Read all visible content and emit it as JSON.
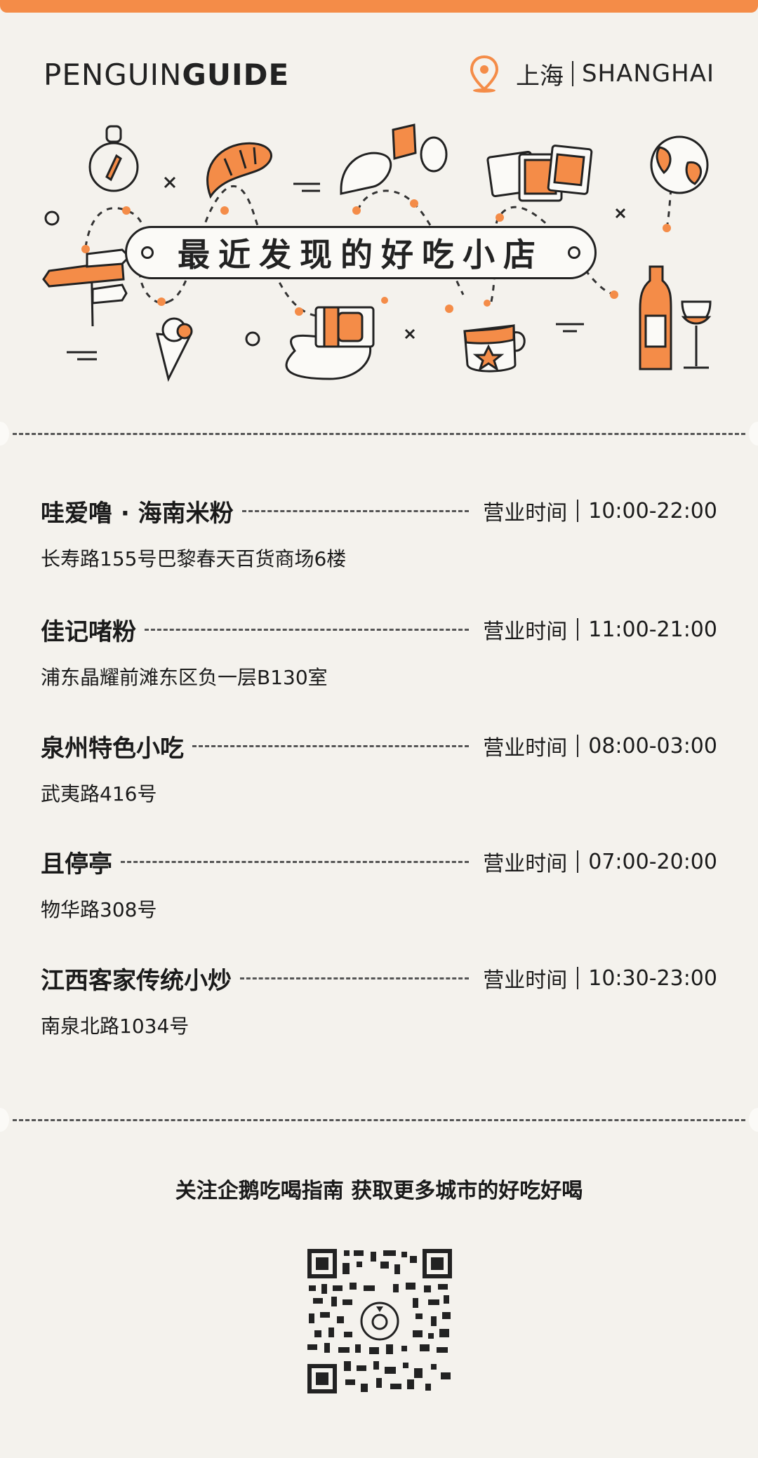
{
  "brand": {
    "light": "PENGUIN",
    "bold": "GUIDE"
  },
  "city": {
    "zh": "上海",
    "en": "SHANGHAI"
  },
  "banner": {
    "title": "最近发现的好吃小店"
  },
  "shops": [
    {
      "name": "哇爱噜 · 海南米粉",
      "hours_label": "营业时间",
      "hours": "10:00-22:00",
      "address": "长寿路155号巴黎春天百货商场6楼"
    },
    {
      "name": "佳记啫粉",
      "hours_label": "营业时间",
      "hours": "11:00-21:00",
      "address": "浦东晶耀前滩东区负一层B130室"
    },
    {
      "name": "泉州特色小吃",
      "hours_label": "营业时间",
      "hours": "08:00-03:00",
      "address": "武夷路416号"
    },
    {
      "name": "且停亭",
      "hours_label": "营业时间",
      "hours": "07:00-20:00",
      "address": "物华路308号"
    },
    {
      "name": "江西客家传统小炒",
      "hours_label": "营业时间",
      "hours": "10:30-23:00",
      "address": "南泉北路1034号"
    }
  ],
  "footer": {
    "follow_text": "关注企鹅吃喝指南   获取更多城市的好吃好喝"
  },
  "colors": {
    "accent": "#f48c48",
    "background": "#f4f2ed",
    "ink": "#222222"
  }
}
